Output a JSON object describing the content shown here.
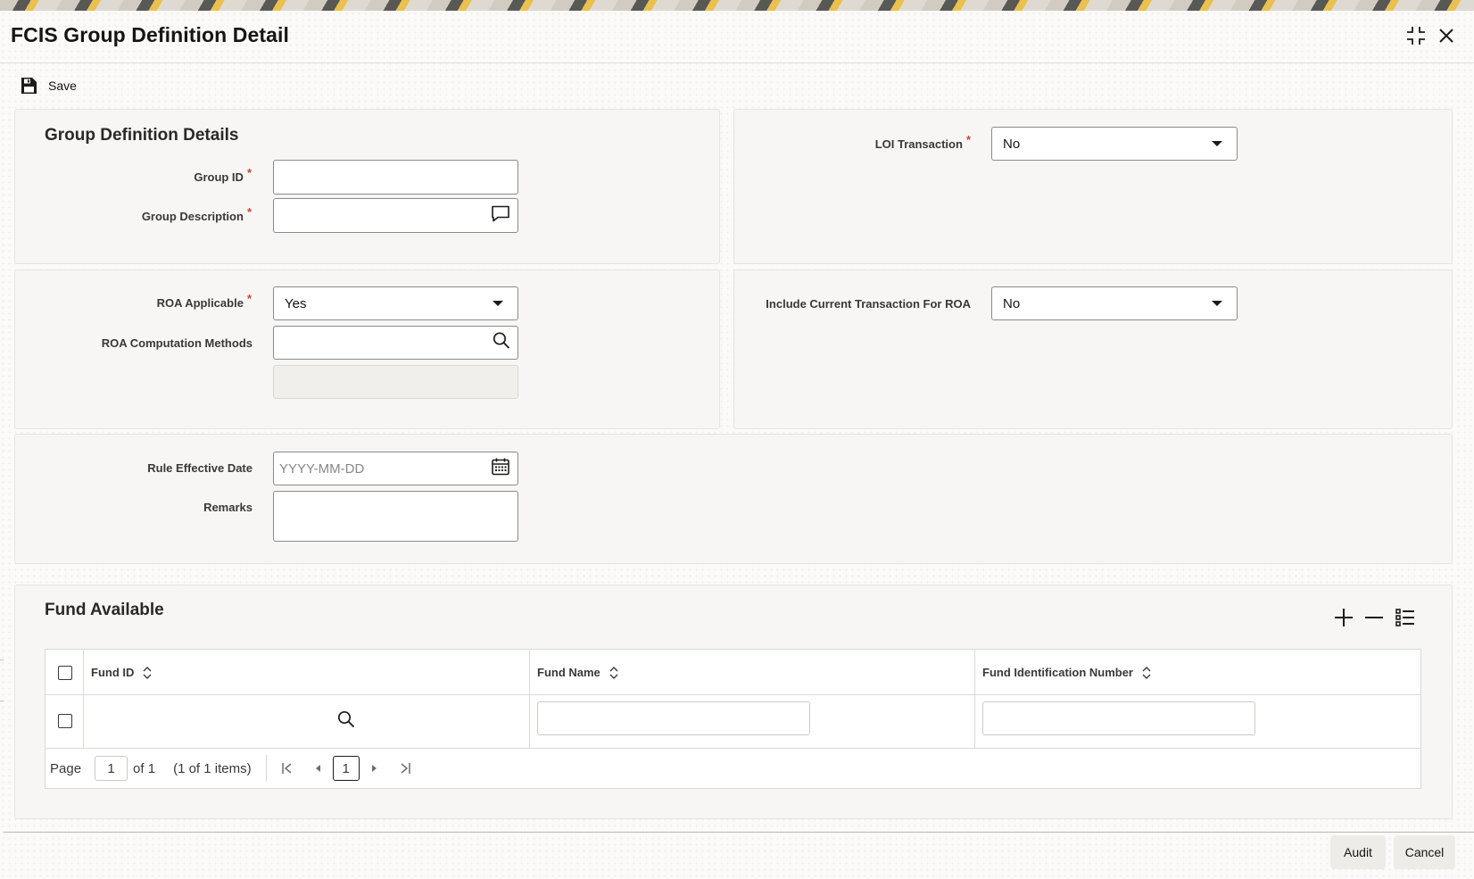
{
  "window": {
    "title": "FCIS Group Definition Detail",
    "icons": {
      "minimize": "collapse-icon",
      "close": "close-icon"
    }
  },
  "toolbar": {
    "save_label": "Save",
    "save_icon": "floppy-disk-icon"
  },
  "group_definition": {
    "section_title": "Group Definition Details",
    "group_id": {
      "label": "Group ID",
      "value": "",
      "required": true
    },
    "group_description": {
      "label": "Group Description",
      "value": "",
      "required": true,
      "icon": "comment-icon"
    },
    "loi_transaction": {
      "label": "LOI Transaction",
      "value": "No",
      "required": true
    }
  },
  "roa": {
    "roa_applicable": {
      "label": "ROA Applicable",
      "value": "Yes",
      "required": true
    },
    "roa_computation_methods": {
      "label": "ROA Computation Methods",
      "value": "",
      "icon": "search-icon"
    },
    "roa_method_description": {
      "value": ""
    },
    "include_current_transaction": {
      "label": "Include Current Transaction For ROA",
      "value": "No"
    }
  },
  "rule": {
    "effective_date": {
      "label": "Rule Effective Date",
      "placeholder": "YYYY-MM-DD",
      "icon": "calendar-icon"
    },
    "remarks": {
      "label": "Remarks",
      "value": ""
    }
  },
  "fund_available": {
    "section_title": "Fund Available",
    "actions": {
      "add": "plus-icon",
      "remove": "minus-icon",
      "columns": "list-icon"
    },
    "columns": [
      "Fund ID",
      "Fund Name",
      "Fund Identification Number"
    ],
    "rows": [
      {
        "fund_id": "",
        "fund_name": "",
        "fund_identification_number": ""
      }
    ],
    "pagination": {
      "page_label": "Page",
      "current_page": "1",
      "of_label": "of 1",
      "items_label": "(1 of 1 items)",
      "page_button": "1"
    }
  },
  "footer": {
    "audit_label": "Audit",
    "cancel_label": "Cancel"
  },
  "colors": {
    "required": "#c74634",
    "panel_bg": "#f7f6f4",
    "border": "#8d8a85"
  }
}
